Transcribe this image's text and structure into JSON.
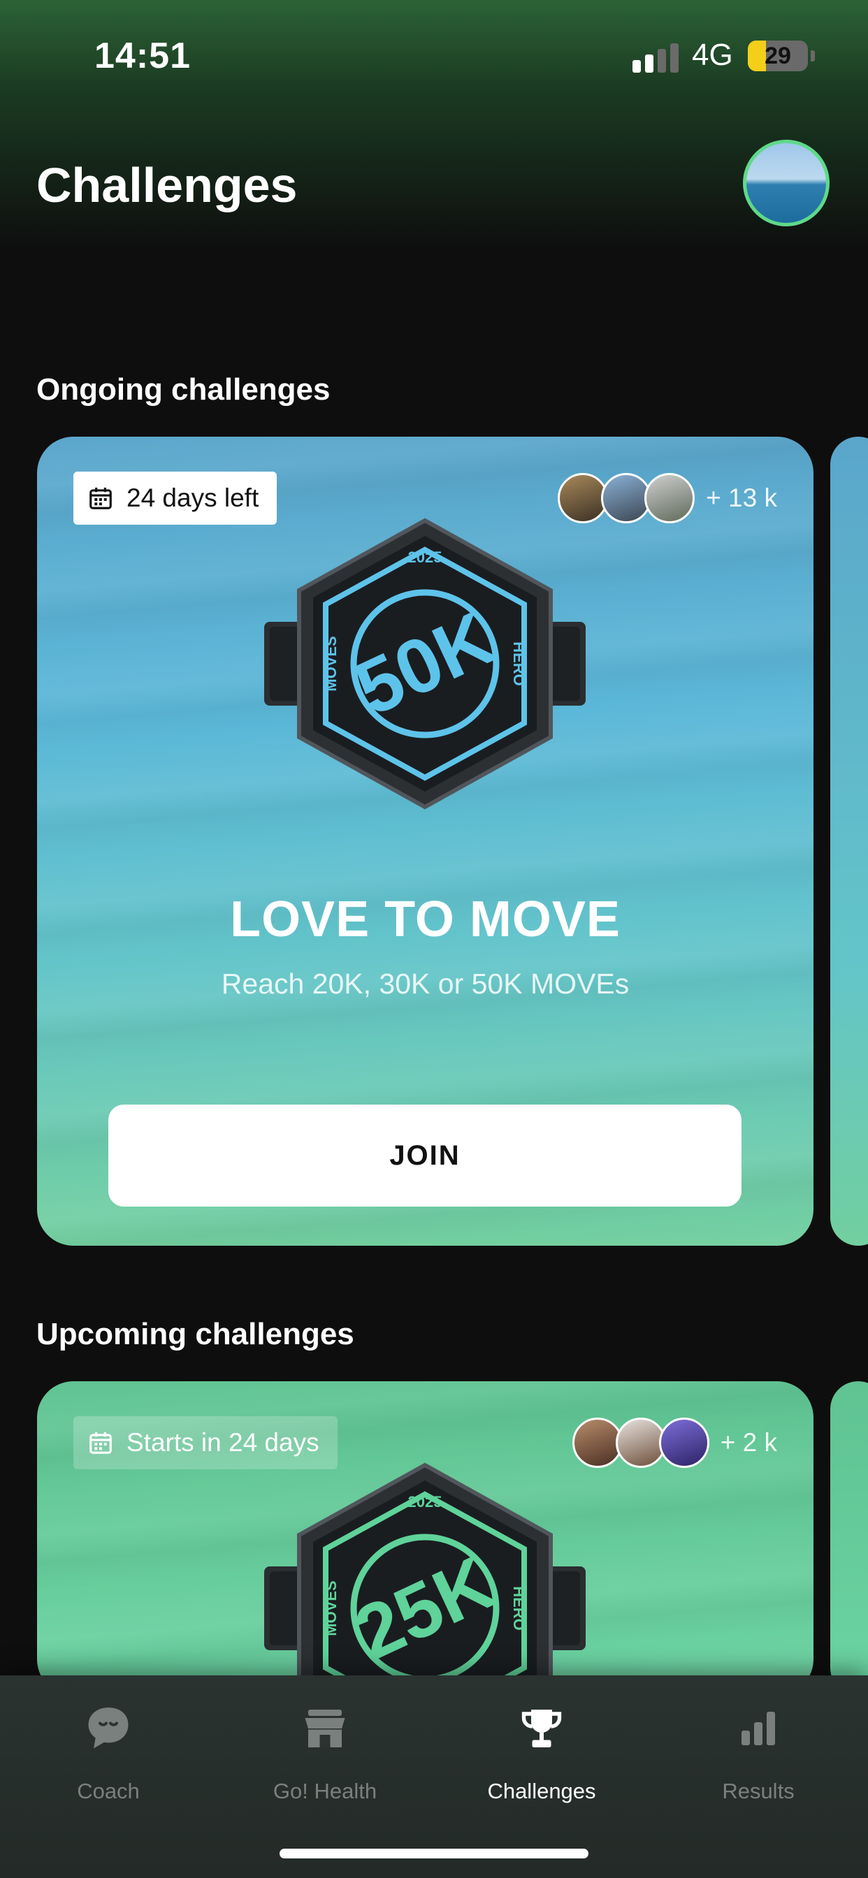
{
  "status_bar": {
    "time": "14:51",
    "network": "4G",
    "battery_level": "29",
    "signal_bars_active": 2,
    "signal_bars_total": 4
  },
  "header": {
    "title": "Challenges"
  },
  "sections": {
    "ongoing": {
      "title": "Ongoing challenges",
      "card": {
        "tag": "24 days left",
        "participants_extra": "+ 13 k",
        "badge": {
          "year": "2025",
          "value": "50K",
          "left_label": "MOVES",
          "right_label": "HERO"
        },
        "title": "LOVE TO MOVE",
        "subtitle": "Reach 20K, 30K or 50K MOVEs",
        "button": "JOIN"
      }
    },
    "upcoming": {
      "title": "Upcoming challenges",
      "card": {
        "tag": "Starts in 24 days",
        "participants_extra": "+ 2 k",
        "badge": {
          "year": "2025",
          "value": "25K",
          "left_label": "MOVES",
          "right_label": "HERO"
        }
      }
    }
  },
  "tab_bar": {
    "tabs": [
      {
        "label": "Coach",
        "icon": "chat-bubble-icon",
        "active": false
      },
      {
        "label": "Go! Health",
        "icon": "store-icon",
        "active": false
      },
      {
        "label": "Challenges",
        "icon": "trophy-icon",
        "active": true
      },
      {
        "label": "Results",
        "icon": "bar-chart-icon",
        "active": false
      }
    ]
  },
  "colors": {
    "accent_green": "#5fd98a",
    "badge_blue": "#5ec3ea",
    "badge_green": "#5fd39a",
    "background": "#0e0e0e"
  }
}
